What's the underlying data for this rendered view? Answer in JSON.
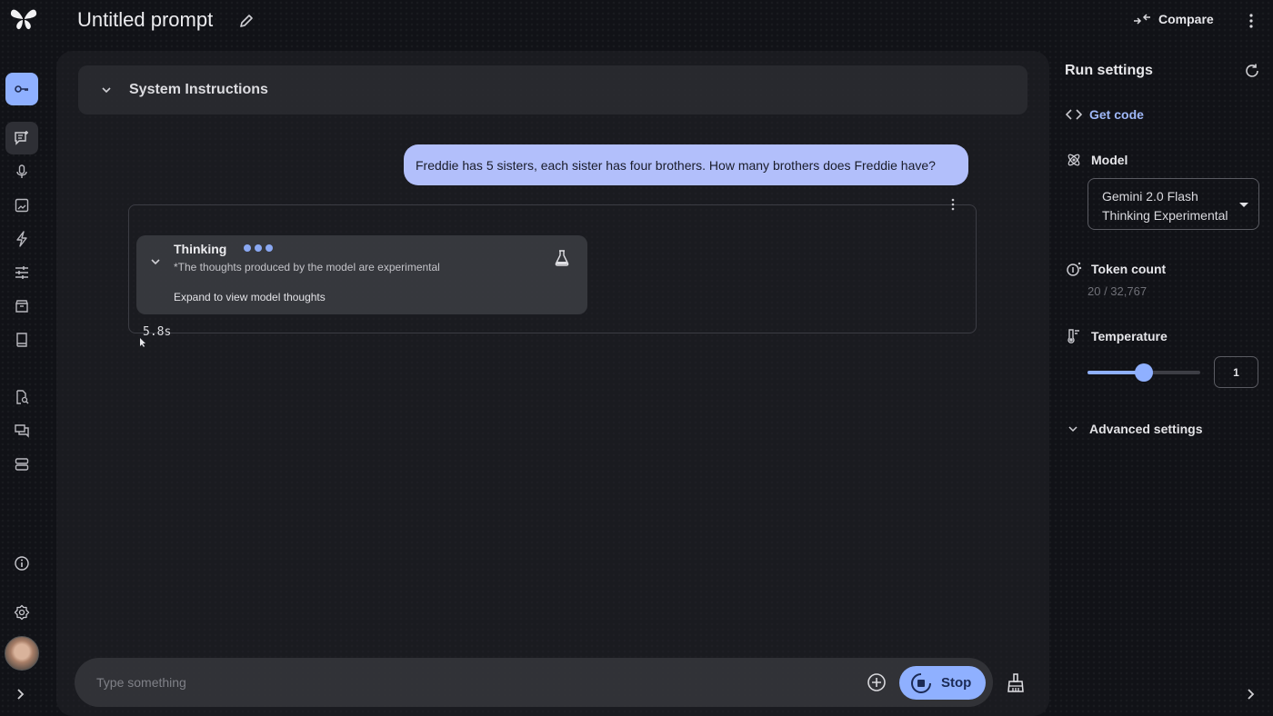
{
  "app": {
    "title": "Untitled prompt",
    "compare_label": "Compare"
  },
  "rail": {
    "items": [
      {
        "name": "get-api-key",
        "icon": "key-icon",
        "active": true
      },
      {
        "name": "create-prompt",
        "icon": "chat-add-icon",
        "active": true
      },
      {
        "name": "stream-realtime",
        "icon": "mic-icon"
      },
      {
        "name": "starter-apps",
        "icon": "image-icon"
      },
      {
        "name": "tune-model",
        "icon": "bolt-icon"
      },
      {
        "name": "settings-tune",
        "icon": "sliders-icon"
      },
      {
        "name": "library",
        "icon": "archive-icon"
      },
      {
        "name": "docs",
        "icon": "book-icon"
      },
      {
        "name": "prompt-gallery",
        "icon": "doc-search-icon"
      },
      {
        "name": "chat-history",
        "icon": "chat-bubbles-icon"
      },
      {
        "name": "storage",
        "icon": "storage-icon"
      },
      {
        "name": "info",
        "icon": "info-icon"
      },
      {
        "name": "settings",
        "icon": "gear-icon"
      }
    ]
  },
  "system_instructions": {
    "label": "System Instructions"
  },
  "conversation": {
    "user_message": "Freddie has 5 sisters, each sister has four brothers. How many brothers does Freddie have?",
    "thinking": {
      "title": "Thinking",
      "note": "*The thoughts produced by the model are experimental",
      "expand_label": "Expand to view model thoughts"
    },
    "elapsed": "5.8s"
  },
  "composer": {
    "placeholder": "Type something",
    "stop_label": "Stop"
  },
  "run_settings": {
    "title": "Run settings",
    "get_code_label": "Get code",
    "model_label": "Model",
    "model_value": "Gemini 2.0 Flash Thinking Experimental",
    "token_count_label": "Token count",
    "token_count_value": "20 / 32,767",
    "temperature_label": "Temperature",
    "temperature_value": "1",
    "temperature_fraction": 0.5,
    "advanced_label": "Advanced settings"
  },
  "colors": {
    "accent": "#8fb0ff",
    "user_bubble": "#b2bffb",
    "link": "#9fb8f8",
    "background": "#111217"
  }
}
